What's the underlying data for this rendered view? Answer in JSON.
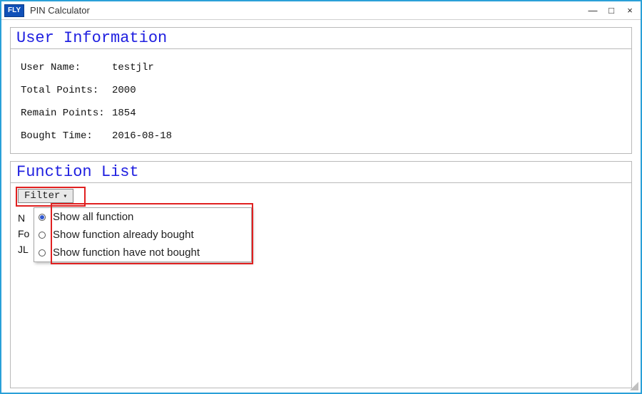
{
  "window": {
    "logo_text": "FLY",
    "title": "PIN Calculator",
    "minimize": "—",
    "maximize": "□",
    "close": "×"
  },
  "user_info": {
    "header": "User Information",
    "rows": {
      "user_name_label": "User Name:",
      "user_name_value": "testjlr",
      "total_points_label": "Total Points:",
      "total_points_value": "2000",
      "remain_points_label": "Remain Points:",
      "remain_points_value": "1854",
      "bought_time_label": "Bought Time:",
      "bought_time_value": "2016-08-18"
    }
  },
  "function_list": {
    "header": "Function List",
    "filter_label": "Filter",
    "dropdown": {
      "opt_all": "Show all function",
      "opt_bought": "Show function already bought",
      "opt_not_bought": "Show function have not bought"
    },
    "bg_rows": {
      "r1": "N",
      "r2": "Fo",
      "r3": "JL"
    }
  }
}
